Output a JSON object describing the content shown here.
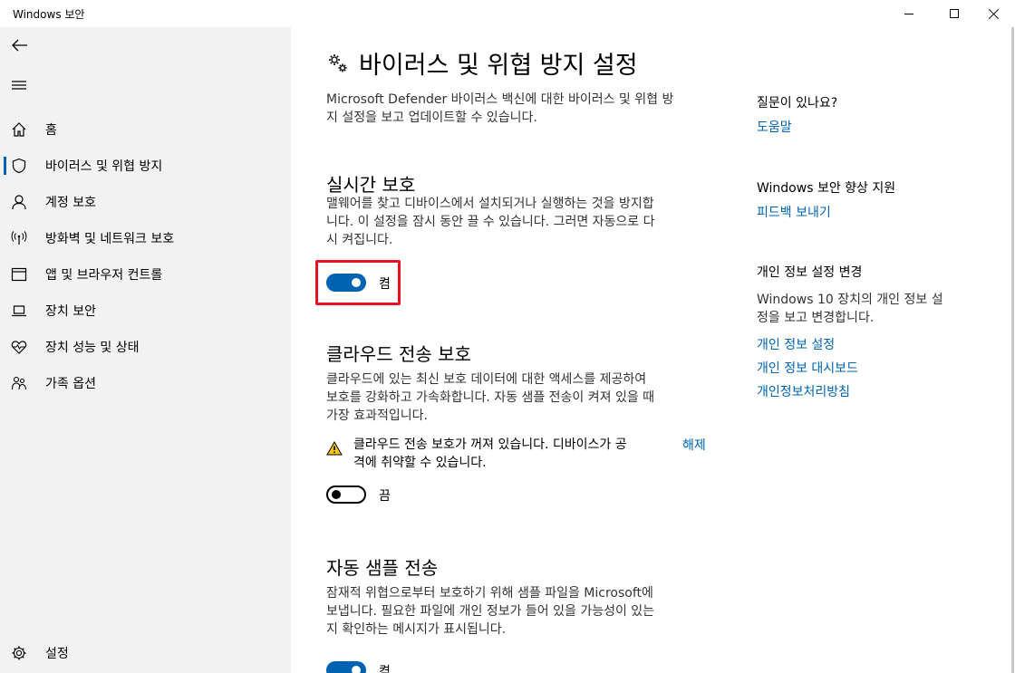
{
  "window": {
    "title": "Windows 보안"
  },
  "sidebar": {
    "items": [
      {
        "label": "홈",
        "icon": "home-icon"
      },
      {
        "label": "바이러스 및 위협 방지",
        "icon": "shield-icon",
        "active": true
      },
      {
        "label": "계정 보호",
        "icon": "person-icon"
      },
      {
        "label": "방화벽 및 네트워크 보호",
        "icon": "antenna-icon"
      },
      {
        "label": "앱 및 브라우저 컨트롤",
        "icon": "browser-window-icon"
      },
      {
        "label": "장치 보안",
        "icon": "laptop-icon"
      },
      {
        "label": "장치 성능 및 상태",
        "icon": "heart-pulse-icon"
      },
      {
        "label": "가족 옵션",
        "icon": "family-icon"
      }
    ],
    "settings_label": "설정"
  },
  "main": {
    "title": "바이러스 및 위협 방지 설정",
    "intro_lines": [
      "Microsoft Defender 바이러스 백신에 대한 바이러스 및 위협 방",
      "지 설정을 보고 업데이트할 수 있습니다."
    ],
    "realtime": {
      "heading": "실시간 보호",
      "desc_lines": [
        "맬웨어를 찾고 디바이스에서 설치되거나 실행하는 것을 방지합",
        "니다. 이 설정을 잠시 동안 끌 수 있습니다. 그러면 자동으로 다",
        "시 켜집니다."
      ],
      "toggle_state": "켬"
    },
    "cloud": {
      "heading": "클라우드 전송 보호",
      "desc_lines": [
        "클라우드에 있는 최신 보호 데이터에 대한 액세스를 제공하여",
        "보호를 강화하고 가속화합니다. 자동 샘플 전송이 켜져 있을 때",
        "가장 효과적입니다."
      ],
      "warning_lines": [
        "클라우드 전송 보호가 꺼져 있습니다. 디바이스가 공",
        "격에 취약할 수 있습니다."
      ],
      "dismiss_label": "해제",
      "toggle_state": "끔"
    },
    "sample": {
      "heading": "자동 샘플 전송",
      "desc_lines": [
        "잠재적 위협으로부터 보호하기 위해 샘플 파일을 Microsoft에",
        "보냅니다. 필요한 파일에 개인 정보가 들어 있을 가능성이 있는",
        "지 확인하는 메시지가 표시됩니다."
      ],
      "toggle_state": "켬"
    }
  },
  "right": {
    "question_heading": "질문이 있나요?",
    "help_link": "도움말",
    "improve_heading": "Windows 보안 향상 지원",
    "feedback_link": "피드백 보내기",
    "privacy_heading": "개인 정보 설정 변경",
    "privacy_desc_lines": [
      "Windows 10 장치의 개인 정보 설",
      "정을 보고 변경합니다."
    ],
    "privacy_settings_link": "개인 정보 설정",
    "privacy_dashboard_link": "개인 정보 대시보드",
    "privacy_statement_link": "개인정보처리방침"
  },
  "colors": {
    "accent": "#0063b1",
    "sidebar_bg": "#f2f2f2",
    "highlight": "#e81123",
    "warning": "#f5c518"
  }
}
